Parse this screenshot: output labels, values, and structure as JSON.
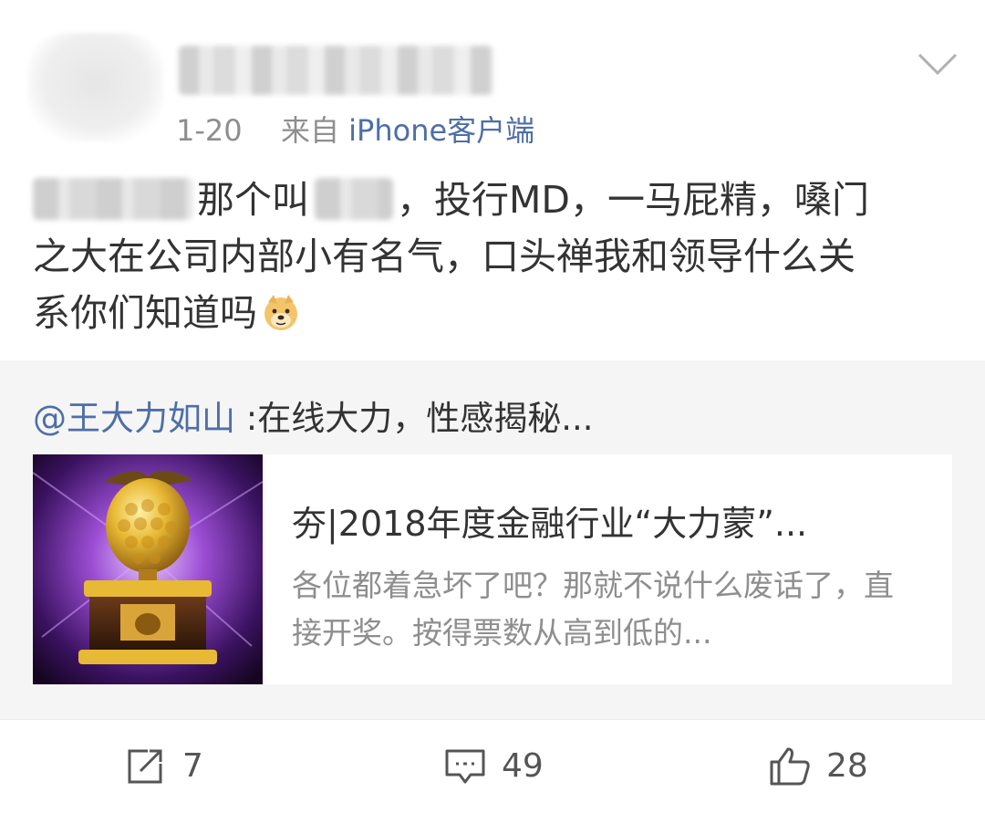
{
  "post": {
    "author": {
      "name_redacted": ""
    },
    "meta": {
      "date": "1-20",
      "source_prefix": "来自 ",
      "source": "iPhone客户端"
    },
    "text": {
      "line1_a": "那个叫",
      "line1_b": "，投行MD，一马屁精，嗓门",
      "line2": "之大在公司内部小有名气，口头禅我和领导什么关",
      "line3": "系你们知道吗",
      "emoji": "doge-emoji"
    }
  },
  "repost": {
    "mention": "@王大力如山",
    "text": " :在线大力，性感揭秘...",
    "card": {
      "title": "夯|2018年度金融行业“大力蒙”...",
      "description": "各位都着急坏了吧？那就不说什么废话了，直接开奖。按得票数从高到低的...",
      "thumbnail": "golden-raspberry-trophy-image"
    }
  },
  "actions": {
    "share": {
      "icon": "share-icon",
      "count": "7"
    },
    "comment": {
      "icon": "comment-icon",
      "count": "49"
    },
    "like": {
      "icon": "thumbs-up-icon",
      "count": "28"
    }
  },
  "colors": {
    "link": "#4e6ea8",
    "meta": "#8e8e8e",
    "text": "#333333",
    "repost_bg": "#f5f5f5"
  }
}
